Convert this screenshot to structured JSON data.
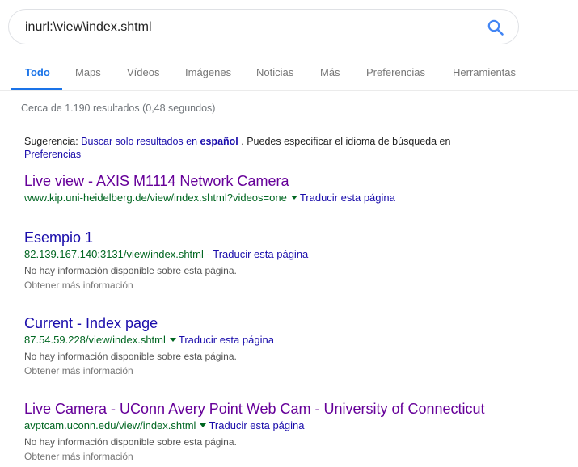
{
  "search": {
    "query": "inurl:\\view\\index.shtml"
  },
  "tabs": [
    {
      "label": "Todo"
    },
    {
      "label": "Maps"
    },
    {
      "label": "Vídeos"
    },
    {
      "label": "Imágenes"
    },
    {
      "label": "Noticias"
    },
    {
      "label": "Más"
    },
    {
      "label": "Preferencias"
    },
    {
      "label": "Herramientas"
    }
  ],
  "stats": "Cerca de 1.190 resultados (0,48 segundos)",
  "suggestion": {
    "prefix": "Sugerencia:",
    "link_text": "Buscar solo resultados en",
    "language": "español",
    "middle": ". Puedes especificar el idioma de búsqueda en",
    "prefs_link": "Preferencias"
  },
  "results": [
    {
      "title": "Live view - AXIS M1114 Network Camera",
      "url": "www.kip.uni-heidelberg.de/view/index.shtml?videos=one",
      "translate": "Traducir esta página"
    },
    {
      "title": "Esempio 1",
      "url": "82.139.167.140:3131/view/index.shtml",
      "separator": "-",
      "translate": "Traducir esta página",
      "snippet": "No hay información disponible sobre esta página.",
      "more": "Obtener más información"
    },
    {
      "title": "Current - Index page",
      "url": "87.54.59.228/view/index.shtml",
      "translate": "Traducir esta página",
      "snippet": "No hay información disponible sobre esta página.",
      "more": "Obtener más información"
    },
    {
      "title": "Live Camera - UConn Avery Point Web Cam - University of Connecticut",
      "url": "avptcam.uconn.edu/view/index.shtml",
      "translate": "Traducir esta página",
      "snippet": "No hay información disponible sobre esta página.",
      "more": "Obtener más información"
    }
  ],
  "colors": {
    "accent": "#1a73e8",
    "visited_link": "#660099",
    "link": "#1a0dab",
    "url_green": "#006621"
  }
}
